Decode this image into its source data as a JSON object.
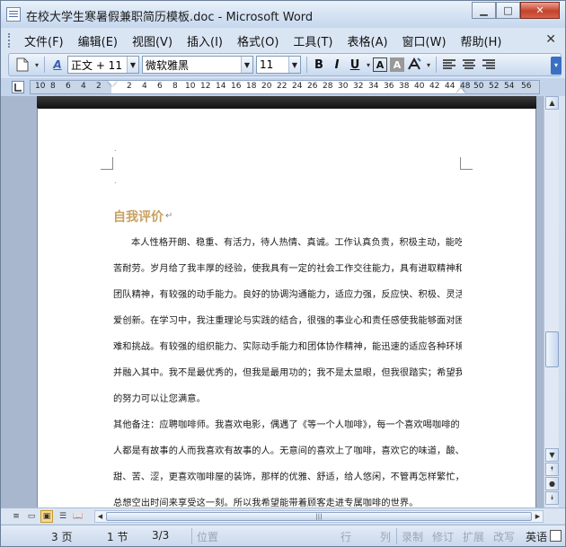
{
  "window": {
    "title": "在校大学生寒暑假兼职简历模板.doc - Microsoft Word",
    "min_glyph": "▁",
    "max_glyph": "□",
    "close_glyph": "✕"
  },
  "menu": {
    "items": [
      "文件(F)",
      "编辑(E)",
      "视图(V)",
      "插入(I)",
      "格式(O)",
      "工具(T)",
      "表格(A)",
      "窗口(W)",
      "帮助(H)"
    ],
    "close_glyph": "✕"
  },
  "toolbar": {
    "style_value": "正文 + 11",
    "font_value": "微软雅黑",
    "size_value": "11",
    "bold": "B",
    "italic": "I",
    "underline": "U",
    "style_icon_glyph": "A"
  },
  "ruler": {
    "ticks": [
      "10",
      "8",
      "6",
      "4",
      "2",
      "2",
      "4",
      "6",
      "8",
      "10",
      "12",
      "14",
      "16",
      "18",
      "20",
      "22",
      "24",
      "26",
      "28",
      "30",
      "32",
      "34",
      "36",
      "38",
      "40",
      "42",
      "44",
      "48",
      "50",
      "52",
      "54",
      "56"
    ]
  },
  "document": {
    "heading": "自我评价",
    "lines": [
      "本人性格开朗、稳重、有活力，待人热情、真诚。工作认真负责，积极主动，能吃",
      "苦耐劳。岁月给了我丰厚的经验，使我具有一定的社会工作交往能力，具有进取精神和",
      "团队精神，有较强的动手能力。良好的协调沟通能力，适应力强，反应快、积极、灵活，",
      "爱创新。在学习中，我注重理论与实践的结合，很强的事业心和责任感使我能够面对困",
      "难和挑战。有较强的组织能力、实际动手能力和团体协作精神，能迅速的适应各种环境，",
      "并融入其中。我不是最优秀的，但我是最用功的；我不是太显眼，但我很踏实；希望我",
      "的努力可以让您满意。",
      "其他备注：应聘咖啡师。我喜欢电影，偶遇了《等一个人咖啡》，每一个喜欢喝咖啡的",
      "人都是有故事的人而我喜欢有故事的人。无意间的喜欢上了咖啡，喜欢它的味道，酸、",
      "甜、苦、涩，更喜欢咖啡屋的装饰，那样的优雅、舒适，给人悠闲，不管再怎样繁忙，",
      "总想空出时间来享受这一刻。所以我希望能带着顾客走进专属咖啡的世界。"
    ]
  },
  "statusbar": {
    "page": "3 页",
    "section": "1 节",
    "page_of": "3/3",
    "position": "位置",
    "line": "行",
    "column": "列",
    "record": "录制",
    "revise": "修订",
    "extend": "扩展",
    "overwrite": "改写",
    "language": "英语"
  }
}
